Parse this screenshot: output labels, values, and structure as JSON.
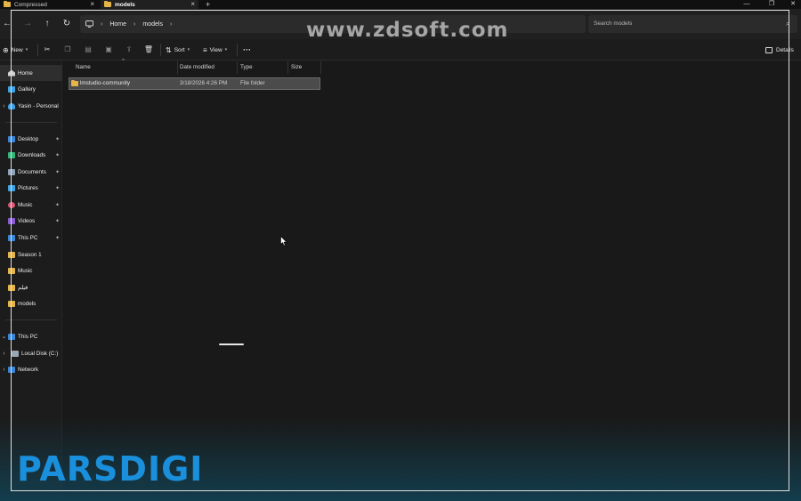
{
  "tabs": [
    {
      "label": "Compressed",
      "active": false
    },
    {
      "label": "models",
      "active": true
    }
  ],
  "new_tab_glyph": "+",
  "window_controls": [
    "—",
    "❐",
    "✕"
  ],
  "nav": {
    "back": "←",
    "forward": "→",
    "up": "↑",
    "refresh": "↻"
  },
  "breadcrumb": [
    "Home",
    "models"
  ],
  "search": {
    "placeholder": "Search models"
  },
  "toolbar": {
    "new_label": "New",
    "sort_label": "Sort",
    "view_label": "View",
    "more_label": "···",
    "details_label": "Details"
  },
  "sidebar": {
    "quick": [
      {
        "label": "Home",
        "icon": "home-icon",
        "color": "#d0d0d0"
      },
      {
        "label": "Gallery",
        "icon": "gallery-icon",
        "color": "#3ba3e6"
      },
      {
        "label": "Yasin - Personal",
        "icon": "cloud-icon",
        "color": "#3ba3e6",
        "expandable": true
      }
    ],
    "pinned": [
      {
        "label": "Desktop",
        "icon": "desktop-icon",
        "color": "#3a86d8",
        "pinned": true
      },
      {
        "label": "Downloads",
        "icon": "downloads-icon",
        "color": "#2fb67a",
        "pinned": true
      },
      {
        "label": "Documents",
        "icon": "documents-icon",
        "color": "#8fa3b8",
        "pinned": true
      },
      {
        "label": "Pictures",
        "icon": "pictures-icon",
        "color": "#3ba3e6",
        "pinned": true
      },
      {
        "label": "Music",
        "icon": "music-icon",
        "color": "#e0577a",
        "pinned": true
      },
      {
        "label": "Videos",
        "icon": "videos-icon",
        "color": "#8b5bd6",
        "pinned": true
      },
      {
        "label": "This PC",
        "icon": "pc-icon",
        "color": "#3a86d8",
        "pinned": true
      },
      {
        "label": "Season 1",
        "icon": "folder-icon",
        "color": "#e6b548",
        "pinned": false
      },
      {
        "label": "Music",
        "icon": "folder-icon",
        "color": "#e6b548",
        "pinned": false
      },
      {
        "label": "فیلم",
        "icon": "folder-icon",
        "color": "#e6b548",
        "pinned": false
      },
      {
        "label": "models",
        "icon": "folder-icon",
        "color": "#e6b548",
        "pinned": false
      }
    ],
    "devices": [
      {
        "label": "This PC",
        "icon": "pc-icon",
        "color": "#3a86d8",
        "expanded": true
      },
      {
        "label": "Local Disk (C:)",
        "icon": "disk-icon",
        "color": "#9aa6b2",
        "child": true
      },
      {
        "label": "Network",
        "icon": "network-icon",
        "color": "#3a86d8"
      }
    ]
  },
  "columns": [
    "Name",
    "Date modified",
    "Type",
    "Size"
  ],
  "files": [
    {
      "name": "lmstudio-community",
      "date": "3/18/2026 4:26 PM",
      "type": "File folder",
      "size": ""
    }
  ],
  "watermark": "www.zdsoft.com",
  "logo_text": "PARSDIGI",
  "colors": {
    "folder": "#e6b548",
    "logo": "#1a8fdc",
    "selection": "#4b4b4b",
    "background": "#191919"
  }
}
